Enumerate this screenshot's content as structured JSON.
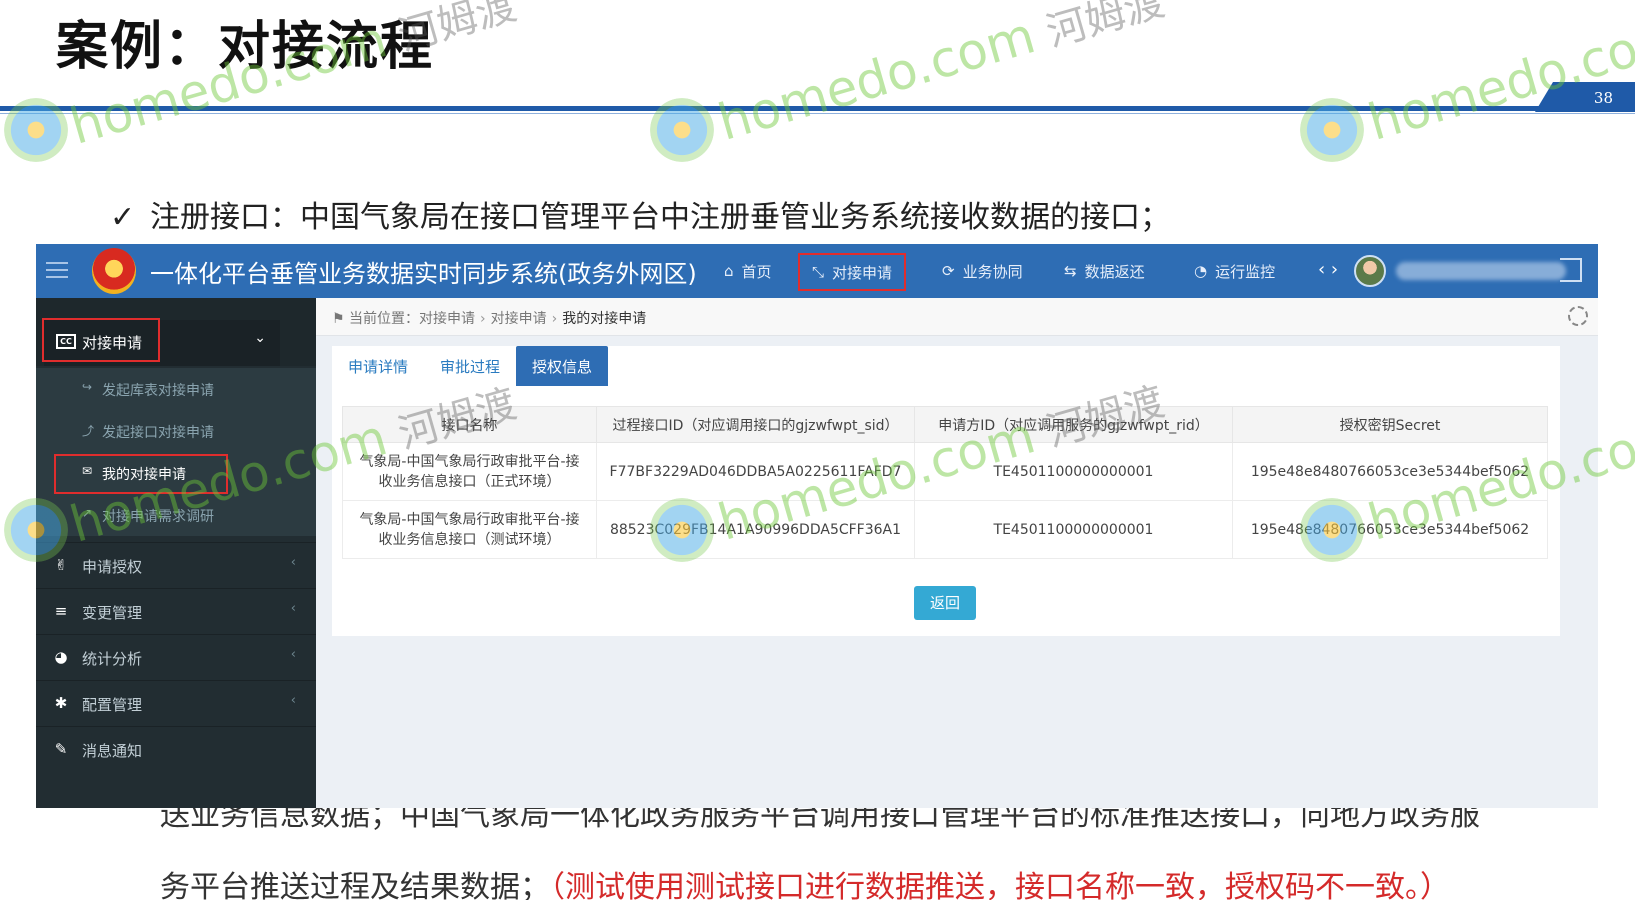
{
  "slide": {
    "title": "案例：对接流程",
    "page_number": "38",
    "bullet_check": "✓",
    "bullet_text": "注册接口：中国气象局在接口管理平台中注册垂管业务系统接收数据的接口；",
    "body_line_1": "送业务信息数据；中国气象局一体化政务服务平台调用接口管理平台的标准推送接口，向地方政务服",
    "body_line_2_black": "务平台推送过程及结果数据；",
    "body_line_2_red": "（测试使用测试接口进行数据推送，接口名称一致，授权码不一致。）"
  },
  "app": {
    "title": "一体化平台垂管业务数据实时同步系统(政务外网区)",
    "nav": [
      {
        "icon": "⌂",
        "label": "首页"
      },
      {
        "icon": "⤡",
        "label": "对接申请"
      },
      {
        "icon": "⟳",
        "label": "业务协同"
      },
      {
        "icon": "⇆",
        "label": "数据返还"
      },
      {
        "icon": "◔",
        "label": "运行监控"
      }
    ],
    "nav_arrows": "‹ ›"
  },
  "sidebar": {
    "section": {
      "label": "对接申请",
      "icon": "CC",
      "chevron": "⌄"
    },
    "sub_items": [
      {
        "icon": "↪",
        "label": "发起库表对接申请"
      },
      {
        "icon": "⤴",
        "label": "发起接口对接申请"
      },
      {
        "icon": "✉",
        "label": "我的对接申请"
      },
      {
        "icon": "↗",
        "label": "对接申请需求调研"
      }
    ],
    "items": [
      {
        "icon": "✌",
        "label": "申请授权",
        "chevron": "‹"
      },
      {
        "icon": "≡",
        "label": "变更管理",
        "chevron": "‹"
      },
      {
        "icon": "◕",
        "label": "统计分析",
        "chevron": "‹"
      },
      {
        "icon": "✱",
        "label": "配置管理",
        "chevron": "‹"
      },
      {
        "icon": "✎",
        "label": "消息通知",
        "chevron": ""
      }
    ]
  },
  "breadcrumb": {
    "icon": "⚑",
    "prefix": "当前位置：",
    "items": [
      "对接申请",
      "对接申请",
      "我的对接申请"
    ],
    "sep": "›"
  },
  "tabs": [
    "申请详情",
    "审批过程",
    "授权信息"
  ],
  "table": {
    "headers": [
      "接口名称",
      "过程接口ID（对应调用接口的gjzwfwpt_sid）",
      "申请方ID（对应调用服务的gjzwfwpt_rid）",
      "授权密钥Secret"
    ],
    "rows": [
      [
        "气象局-中国气象局行政审批平台-接收业务信息接口（正式环境）",
        "F77BF3229AD046DDBA5A0225611FAFD7",
        "TE4501100000000001",
        "195e48e8480766053ce3e5344bef5062"
      ],
      [
        "气象局-中国气象局行政审批平台-接收业务信息接口（测试环境）",
        "88523C029FB14A1A90996DDA5CFF36A1",
        "TE4501100000000001",
        "195e48e8480766053ce3e5344bef5062"
      ]
    ]
  },
  "back_button": "返回",
  "watermark": {
    "latin": "homedo.com",
    "cn": "河姆渡"
  },
  "colors": {
    "topbar": "#2e6db4",
    "sidebar": "#222d32",
    "highlight": "#e02d2d",
    "button": "#34a9d4",
    "red_text": "#d42a2a"
  }
}
